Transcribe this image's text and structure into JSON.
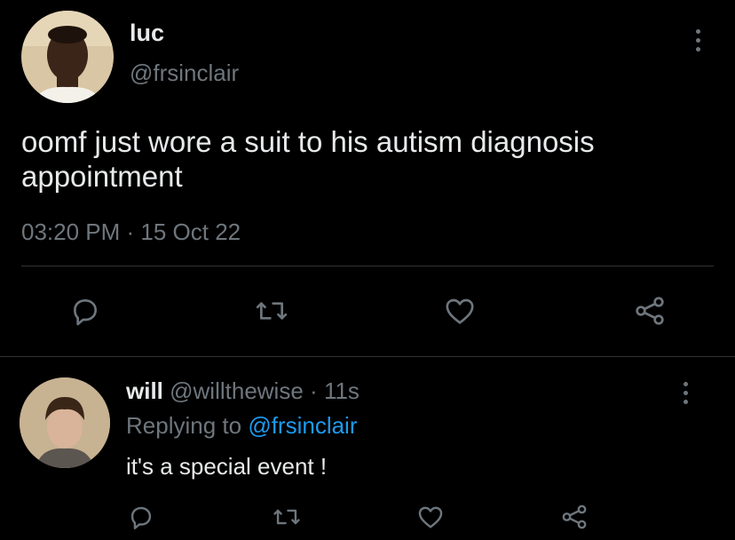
{
  "main_tweet": {
    "display_name": "luc",
    "handle": "@frsinclair",
    "text": "oomf just wore a suit to his autism diagnosis appointment",
    "timestamp": "03:20 PM · 15 Oct 22",
    "actions": [
      "reply-icon",
      "retweet-icon",
      "like-icon",
      "share-icon"
    ]
  },
  "reply_tweet": {
    "display_name": "will",
    "handle": "@willthewise",
    "separator": "·",
    "time_ago": "11s",
    "replying_prefix": "Replying to",
    "replying_handle": "@frsinclair",
    "text": "it's a special event !",
    "actions": [
      "reply-icon",
      "retweet-icon",
      "like-icon",
      "share-icon"
    ]
  },
  "colors": {
    "background": "#000000",
    "text": "#e7e9ea",
    "muted": "#6e767d",
    "link": "#1d9bf0",
    "divider": "#2f3336"
  }
}
